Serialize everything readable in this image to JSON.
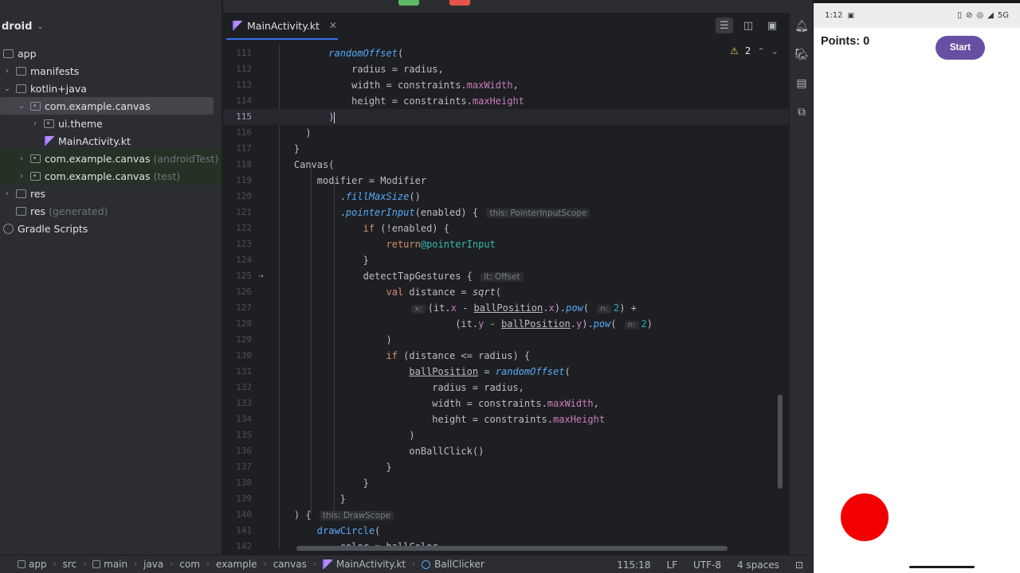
{
  "project": {
    "header": "droid",
    "items": [
      {
        "label": "app",
        "sub": ""
      },
      {
        "label": "manifests",
        "sub": ""
      },
      {
        "label": "kotlin+java",
        "sub": ""
      },
      {
        "label": "com.example.canvas",
        "sub": ""
      },
      {
        "label": "ui.theme",
        "sub": ""
      },
      {
        "label": "MainActivity.kt",
        "sub": ""
      },
      {
        "label": "com.example.canvas",
        "sub": "(androidTest)"
      },
      {
        "label": "com.example.canvas",
        "sub": "(test)"
      },
      {
        "label": "res",
        "sub": ""
      },
      {
        "label": "res",
        "sub": "(generated)"
      },
      {
        "label": "Gradle Scripts",
        "sub": ""
      }
    ]
  },
  "editor": {
    "tab_label": "MainActivity.kt",
    "warnings_count": "2",
    "line_numbers": [
      "111",
      "112",
      "113",
      "114",
      "115",
      "116",
      "117",
      "118",
      "119",
      "120",
      "121",
      "122",
      "123",
      "124",
      "125",
      "126",
      "127",
      "128",
      "129",
      "130",
      "131",
      "132",
      "133",
      "134",
      "135",
      "136",
      "137",
      "138",
      "139",
      "140",
      "141",
      "142"
    ],
    "hints": {
      "pointer_scope": "this: PointerInputScope",
      "offset": "it: Offset",
      "x": "x:",
      "n1": "n:",
      "n2": "n:",
      "draw_scope": "this: DrawScope"
    }
  },
  "statusbar": {
    "breadcrumbs": [
      "app",
      "src",
      "main",
      "java",
      "com",
      "example",
      "canvas",
      "MainActivity.kt",
      "BallClicker"
    ],
    "position": "115:18",
    "line_ending": "LF",
    "encoding": "UTF-8",
    "indent": "4 spaces"
  },
  "phone": {
    "time": "1:12",
    "network": "5G",
    "points_label": "Points: 0",
    "start_label": "Start",
    "ball_color": "#f20000",
    "button_color": "#6750a4"
  }
}
